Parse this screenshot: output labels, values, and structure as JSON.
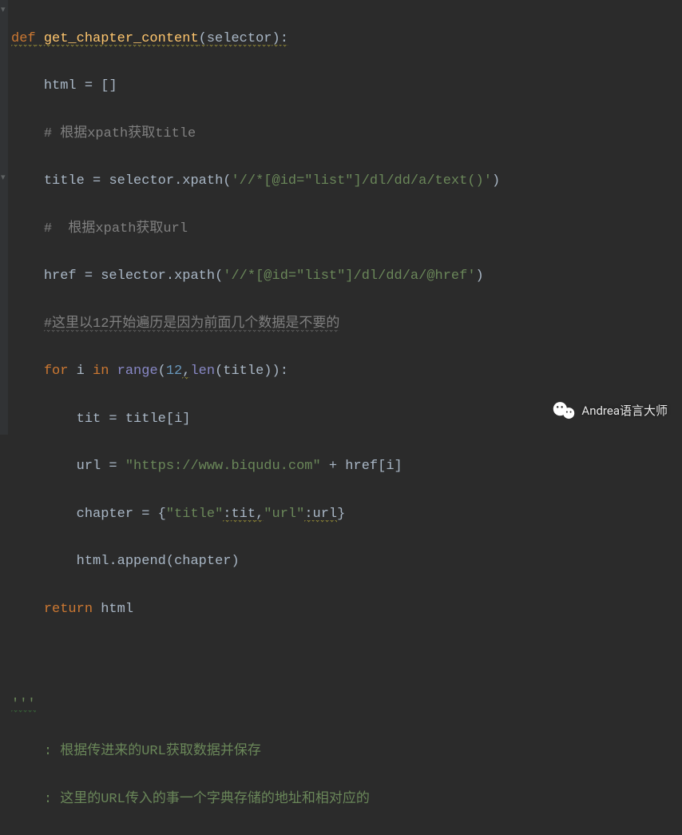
{
  "code": {
    "l1": {
      "def": "def",
      "name": "get_chapter_content",
      "lp": "(",
      "param": "selector",
      "rp": ")",
      "colon": ":"
    },
    "l2": {
      "indent": "    ",
      "v": "html",
      "eq": " = ",
      "lb": "[",
      "rb": "]"
    },
    "l3": {
      "indent": "    ",
      "cmt": "# 根据xpath获取title"
    },
    "l4": {
      "indent": "    ",
      "v": "title",
      "eq": " = ",
      "obj": "selector",
      "dot": ".",
      "m": "xpath",
      "lp": "(",
      "s": "'//*[@id=\"list\"]/dl/dd/a/text()'",
      "rp": ")"
    },
    "l5": {
      "indent": "    ",
      "cmt": "#  根据xpath获取url"
    },
    "l6": {
      "indent": "    ",
      "v": "href",
      "eq": " = ",
      "obj": "selector",
      "dot": ".",
      "m": "xpath",
      "lp": "(",
      "s": "'//*[@id=\"list\"]/dl/dd/a/@href'",
      "rp": ")"
    },
    "l7": {
      "indent": "    ",
      "cmt": "#这里以12开始遍历是因为前面几个数据是不要的"
    },
    "l8": {
      "indent": "    ",
      "for": "for",
      "i": " i ",
      "in": "in",
      "sp": " ",
      "range": "range",
      "lp": "(",
      "n": "12",
      "comma": ",",
      "len": "len",
      "lp2": "(",
      "arg": "title",
      "rp2": ")",
      "rp": ")",
      "colon": ":"
    },
    "l9": {
      "indent": "        ",
      "v": "tit",
      "eq": " = ",
      "arr": "title",
      "lb": "[",
      "i": "i",
      "rb": "]"
    },
    "l10": {
      "indent": "        ",
      "v": "url",
      "eq": " = ",
      "s": "\"https://www.biqudu.com\"",
      "plus": " + ",
      "arr": "href",
      "lb": "[",
      "i": "i",
      "rb": "]"
    },
    "l11": {
      "indent": "        ",
      "v": "chapter",
      "eq": " = ",
      "lb": "{",
      "k1": "\"title\"",
      "c1": ":",
      "v1": "tit",
      "comma": ",",
      "k2": "\"url\"",
      "c2": ":",
      "v2": "url",
      "rb": "}"
    },
    "l12": {
      "indent": "        ",
      "obj": "html",
      "dot": ".",
      "m": "append",
      "lp": "(",
      "arg": "chapter",
      "rp": ")"
    },
    "l13": {
      "indent": "    ",
      "ret": "return",
      "sp": " ",
      "v": "html"
    },
    "l14": {
      "txt": ""
    },
    "l15": {
      "q": "'''"
    },
    "l16": {
      "indent": "    ",
      "doc": ": 根据传进来的URL获取数据并保存"
    },
    "l17": {
      "indent": "    ",
      "doc": ": 这里的URL传入的事一个字典存储的地址和相对应的"
    }
  },
  "watermark": {
    "label": "Andrea语言大师"
  }
}
